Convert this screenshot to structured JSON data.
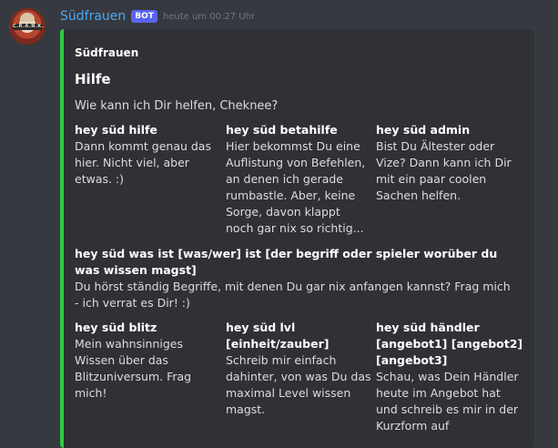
{
  "message": {
    "avatar_text": "C.R.A.N.K.",
    "username": "Südfrauen",
    "bot_tag": "BOT",
    "timestamp": "heute um 00:27 Uhr"
  },
  "embed": {
    "accent_color": "#2ecc40",
    "author": "Südfrauen",
    "title": "Hilfe",
    "description": "Wie kann ich Dir helfen, Cheknee?",
    "fields": [
      {
        "name": "hey süd hilfe",
        "value": "Dann kommt genau das hier. Nicht viel, aber etwas. :)"
      },
      {
        "name": "hey süd betahilfe",
        "value": "Hier bekommst Du eine Auflistung von Befehlen, an denen ich gerade rumbastle. Aber, keine Sorge, davon klappt noch gar nix so richtig..."
      },
      {
        "name": "hey süd admin",
        "value": "Bist Du Ältester oder Vize? Dann kann ich Dir mit ein paar coolen Sachen helfen."
      },
      {
        "name": "hey süd was ist [was/wer] ist [der begriff oder spieler worüber du was wissen magst]",
        "value": "Du hörst ständig Begriffe, mit denen Du gar nix anfangen kannst? Frag mich - ich verrat es Dir! :)"
      },
      {
        "name": "hey süd blitz",
        "value": "Mein wahnsinniges Wissen über das Blitzuniversum. Frag mich!"
      },
      {
        "name": "hey süd lvl [einheit/zauber]",
        "value": "Schreib mir einfach dahinter, von was Du das maximal Level wissen magst."
      },
      {
        "name": "hey süd händler [angebot1] [angebot2] [angebot3]",
        "value": "Schau, was Dein Händler heute im Angebot hat und schreib es mir in der Kurzform auf"
      }
    ]
  }
}
